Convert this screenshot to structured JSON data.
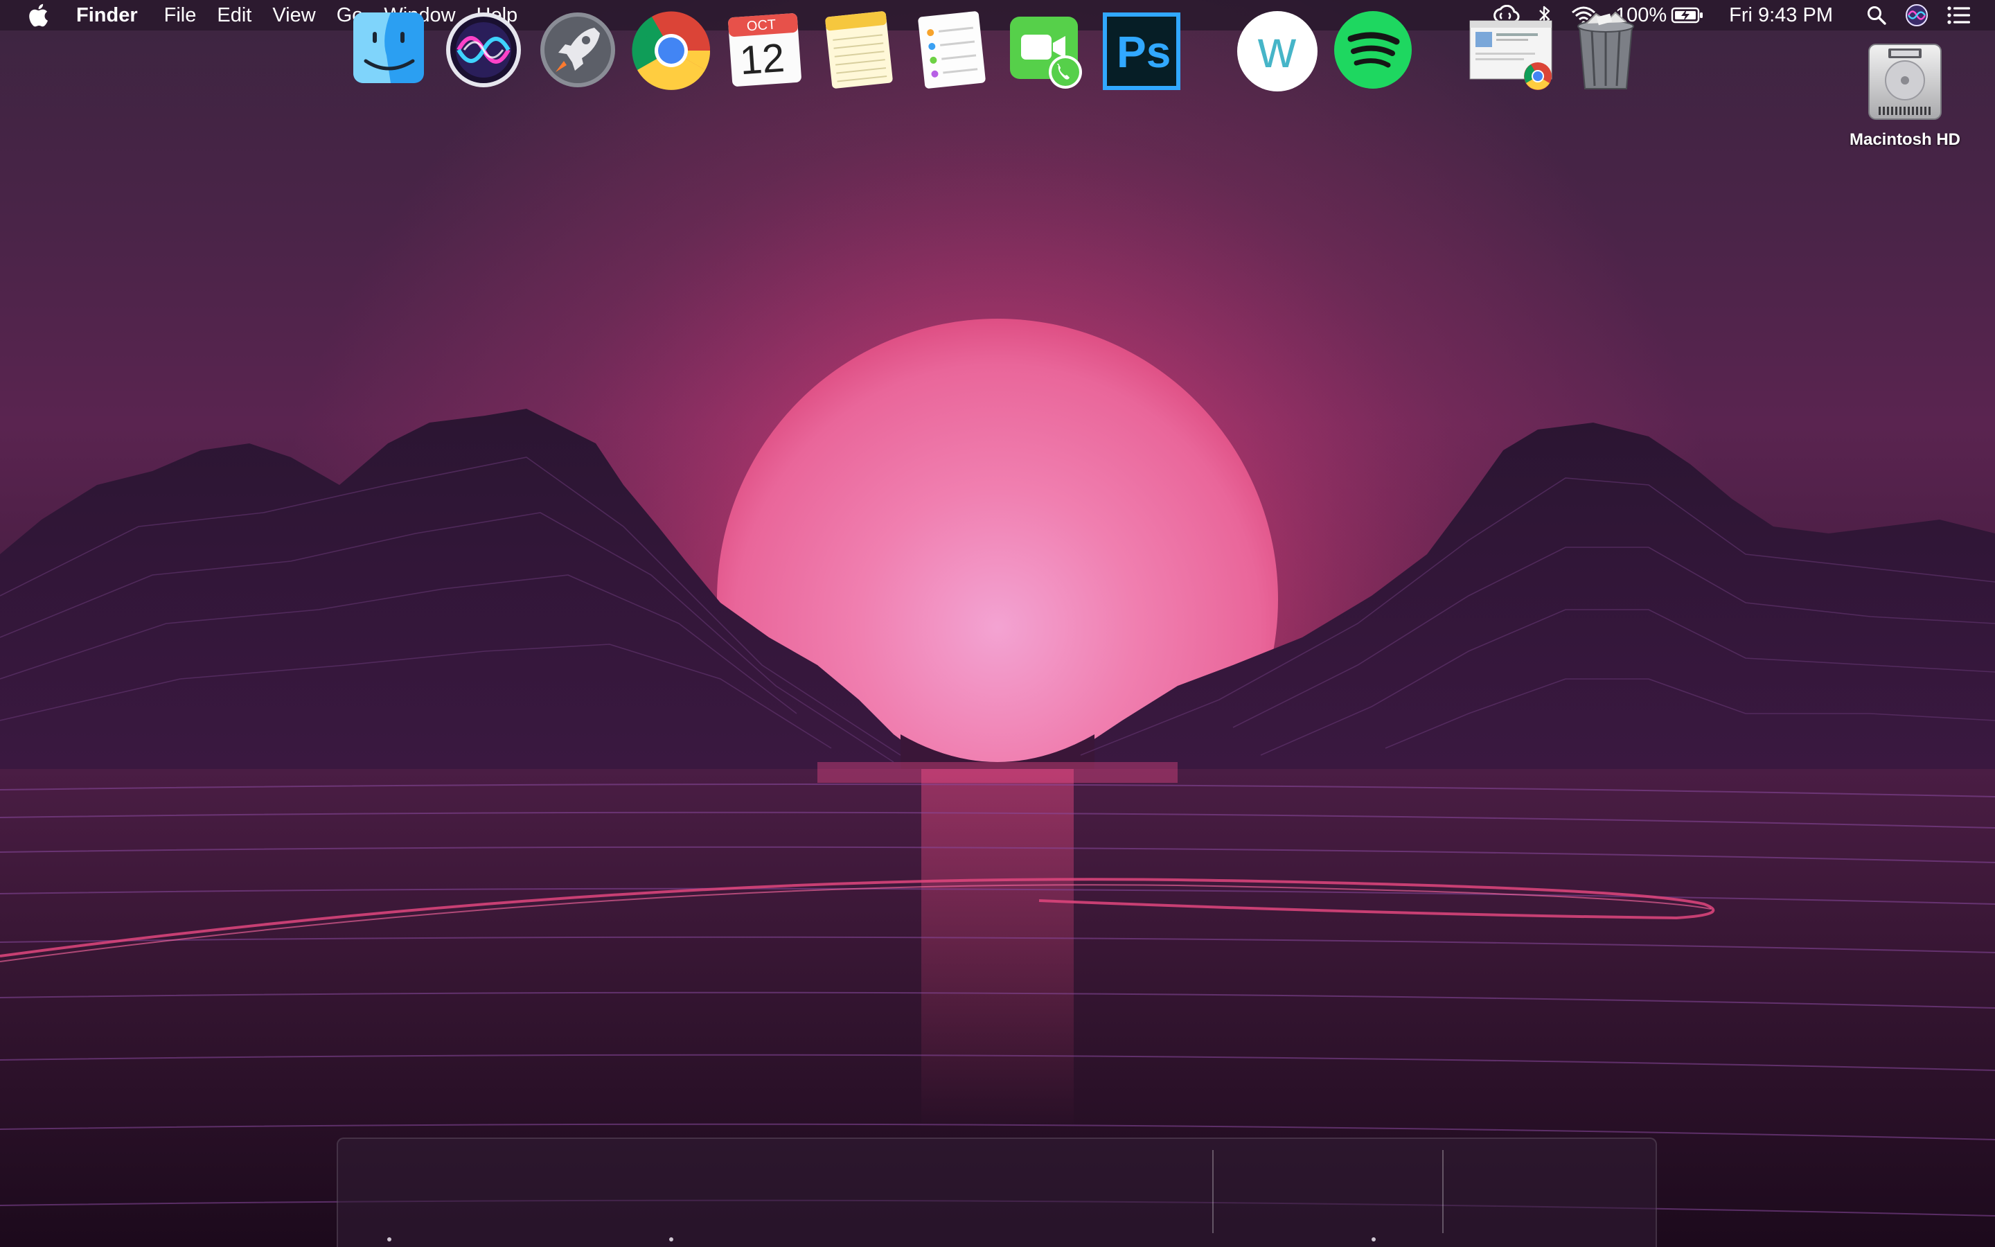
{
  "menubar": {
    "app_name": "Finder",
    "items": [
      "File",
      "Edit",
      "View",
      "Go",
      "Window",
      "Help"
    ],
    "battery_percent": "100%",
    "clock": "Fri 9:43 PM",
    "status_icons": [
      "creative-cloud-icon",
      "bluetooth-icon",
      "wifi-icon",
      "battery-charging-icon",
      "spotlight-search-icon",
      "siri-icon",
      "notification-center-icon"
    ]
  },
  "desktop": {
    "drive_label": "Macintosh HD"
  },
  "dock": {
    "calendar_month": "OCT",
    "calendar_day": "12",
    "apps": [
      "Finder",
      "Siri",
      "Launchpad",
      "Google Chrome",
      "Calendar",
      "Notes",
      "Reminders",
      "FaceTime",
      "Adobe Photoshop",
      "Wunderlist",
      "Spotify",
      "Chrome window",
      "Trash"
    ],
    "photoshop_label": "Ps",
    "wunderlist_label": "w"
  },
  "colors": {
    "sun": "#f07ca8",
    "mountain": "#2a1530",
    "accent_pink": "#e0467e",
    "spotify_green": "#1ed760",
    "photoshop_blue": "#31a8ff"
  }
}
